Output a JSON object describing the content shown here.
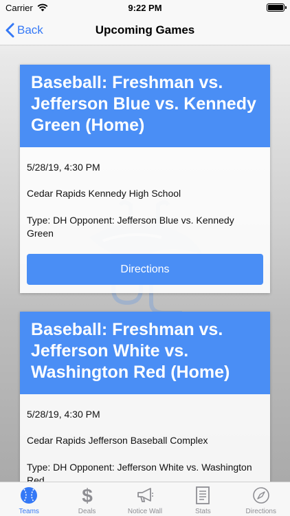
{
  "status_bar": {
    "carrier": "Carrier",
    "time": "9:22 PM"
  },
  "nav": {
    "back_label": "Back",
    "title": "Upcoming Games"
  },
  "games": [
    {
      "title": "Baseball: Freshman vs. Jefferson Blue vs. Kennedy Green (Home)",
      "datetime": "5/28/19, 4:30 PM",
      "location": "Cedar Rapids Kennedy High School",
      "details": "Type: DH Opponent: Jefferson Blue vs. Kennedy Green",
      "button_label": "Directions"
    },
    {
      "title": "Baseball: Freshman vs. Jefferson White vs. Washington Red (Home)",
      "datetime": "5/28/19, 4:30 PM",
      "location": "Cedar Rapids Jefferson Baseball Complex",
      "details": "Type: DH Opponent: Jefferson White vs. Washington Red"
    }
  ],
  "tabs": [
    {
      "label": "Teams",
      "icon": "baseball-icon",
      "active": true
    },
    {
      "label": "Deals",
      "icon": "dollar-icon"
    },
    {
      "label": "Notice Wall",
      "icon": "megaphone-icon"
    },
    {
      "label": "Stats",
      "icon": "document-icon"
    },
    {
      "label": "Directions",
      "icon": "compass-icon"
    }
  ],
  "colors": {
    "accent": "#3478f6",
    "card_header": "#4a8ef5",
    "tab_inactive": "#8e8e93"
  }
}
